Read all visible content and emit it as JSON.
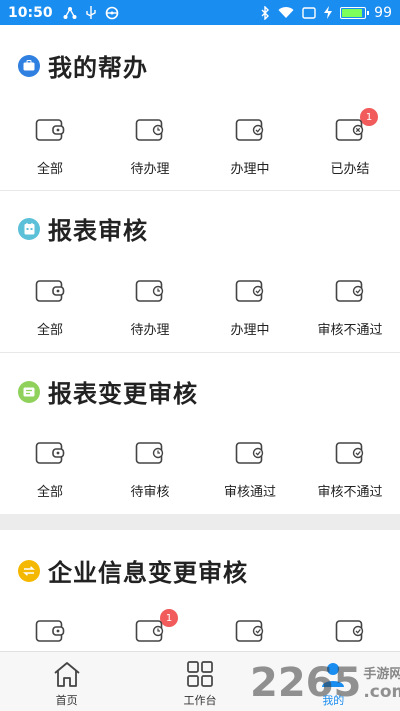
{
  "status_bar": {
    "time": "10:50",
    "battery": "99"
  },
  "sections": [
    {
      "title": "我的帮办",
      "icon_color": "#2f80e0",
      "icon": "briefcase-icon",
      "items": [
        {
          "label": "全部",
          "badge": ""
        },
        {
          "label": "待办理",
          "badge": ""
        },
        {
          "label": "办理中",
          "badge": ""
        },
        {
          "label": "已办结",
          "badge": "1"
        }
      ]
    },
    {
      "title": "报表审核",
      "icon_color": "#5bc0d8",
      "icon": "report-icon",
      "items": [
        {
          "label": "全部",
          "badge": ""
        },
        {
          "label": "待办理",
          "badge": ""
        },
        {
          "label": "办理中",
          "badge": ""
        },
        {
          "label": "审核不通过",
          "badge": ""
        }
      ]
    },
    {
      "title": "报表变更审核",
      "icon_color": "#8fd15a",
      "icon": "report-change-icon",
      "items": [
        {
          "label": "全部",
          "badge": ""
        },
        {
          "label": "待审核",
          "badge": ""
        },
        {
          "label": "审核通过",
          "badge": ""
        },
        {
          "label": "审核不通过",
          "badge": ""
        }
      ]
    },
    {
      "title": "企业信息变更审核",
      "icon_color": "#f5b800",
      "icon": "swap-icon",
      "items": [
        {
          "label": "",
          "badge": ""
        },
        {
          "label": "",
          "badge": "1"
        },
        {
          "label": "",
          "badge": ""
        },
        {
          "label": "",
          "badge": ""
        }
      ]
    }
  ],
  "tabbar": [
    {
      "label": "首页",
      "icon": "home-icon",
      "active": false
    },
    {
      "label": "工作台",
      "icon": "grid-icon",
      "active": false
    },
    {
      "label": "我的",
      "icon": "user-icon",
      "active": true
    }
  ],
  "watermark": {
    "number": "2265",
    "cn": "手游网",
    "com": ".com"
  },
  "colors": {
    "statusbar": "#1a8df0",
    "active_tab": "#1a8df0",
    "badge": "#f15b5b"
  }
}
